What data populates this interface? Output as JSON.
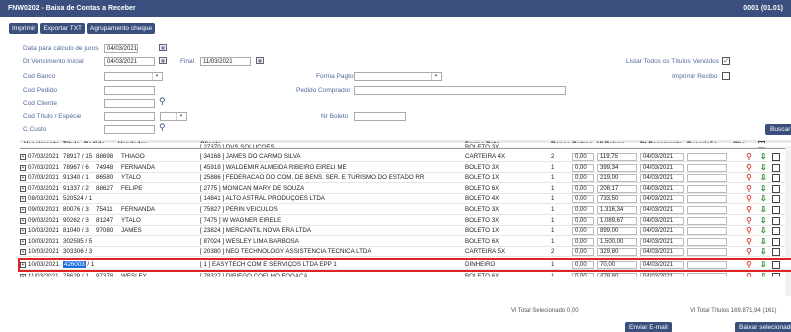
{
  "window": {
    "title": "FNW0202 - Baixa de Contas a Receber",
    "page_indicator": "0001 (01.01)"
  },
  "toolbar": {
    "imprimir": "Imprimir",
    "exportar": "Exportar TXT",
    "agrupamento": "Agrupamento cheque"
  },
  "filters": {
    "data_calc_label": "Data para cálculo de juros",
    "data_calc_value": "04/03/2021",
    "dt_venc_ini_label": "Dt Vencimento Inicial",
    "dt_venc_ini_value": "04/03/2021",
    "final_label": "Final",
    "final_value": "11/03/2021",
    "listar_label": "Listar Todos os Títulos Vencidos",
    "listar_checked": "✓",
    "cod_banco_label": "Cod Banco",
    "forma_pgto_label": "Forma Pagto",
    "imprimir_recibo_label": "Imprimir Recibo",
    "cod_pedido_label": "Cod Pedido",
    "pedido_comprador_label": "Pedido Comprador",
    "cod_cliente_label": "Cod Cliente",
    "cod_titulo_label": "Cod Título / Espécie",
    "nr_boleto_label": "Nr Boleto",
    "ccusto_label": "C.Custo",
    "buscar": "Buscar"
  },
  "grid": {
    "headers": {
      "vencimento": "Vencimento",
      "titulo": "Título",
      "pedido": "Pedido",
      "vendedor": "Vendedor",
      "cliente": "Cliente",
      "forma_pgto": "Forma Pgto",
      "banco": "Banco",
      "outros": "Outros",
      "vl_baixar": "Vl Baixar",
      "dt_pagamento": "Dt Pagamento",
      "descricao": "Descrição",
      "obs": "Obs."
    },
    "partial_top": {
      "venc": "",
      "titulo": "",
      "pedido": "",
      "vend": "",
      "cliente": "[ 27370 ] DVS SOLUCOES ...",
      "forma": "BOLETO 3X"
    },
    "rows": [
      {
        "venc": "07/03/2021",
        "titulo": "78917 / 15",
        "pedido": "88698",
        "vend": "THIAGO",
        "cliente": "[ 34168 ]  JAMES DO CARMO SILVA",
        "forma": "CARTEIRA 4X",
        "banco": "2",
        "outros": "0,00",
        "vl": "119,75",
        "dt": "04/03/2021"
      },
      {
        "venc": "07/03/2021",
        "titulo": "78967 / 6",
        "pedido": "74948",
        "vend": "FERNANDA",
        "cliente": "[ 45918 ]  WALDEMIR ALMEIDA RIBEIRO EIRELI ME",
        "forma": "BOLETO 3X",
        "banco": "1",
        "outros": "0,00",
        "vl": "399,34",
        "dt": "04/03/2021"
      },
      {
        "venc": "07/03/2021",
        "titulo": "91340 / 1",
        "pedido": "86580",
        "vend": "YTALO",
        "cliente": "[ 25886 ]  FEDERACAO DO COM. DE BENS. SER. E TURISMO DO ESTADO RR",
        "forma": "BOLETO 1X",
        "banco": "1",
        "outros": "0,00",
        "vl": "219,00",
        "dt": "04/03/2021"
      },
      {
        "venc": "07/03/2021",
        "titulo": "91337 / 2",
        "pedido": "88627",
        "vend": "FELIPE",
        "cliente": "[ 2775 ]  MONICAN MARY DE SOUZA",
        "forma": "BOLETO 6X",
        "banco": "1",
        "outros": "0,00",
        "vl": "208,17",
        "dt": "04/03/2021"
      },
      {
        "venc": "08/03/2021",
        "titulo": "520524 / 1",
        "pedido": "",
        "vend": "",
        "cliente": "[ 14841 ]  ALTO ASTRAL PRODUÇÕES LTDA",
        "forma": "BOLETO 4X",
        "banco": "1",
        "outros": "0,00",
        "vl": "733,50",
        "dt": "04/03/2021"
      },
      {
        "venc": "09/03/2021",
        "titulo": "80076 / 3",
        "pedido": "75411",
        "vend": "FERNANDA",
        "cliente": "[ 75827 ]  PERIN VEICULOS",
        "forma": "BOLETO 3X",
        "banco": "1",
        "outros": "0,00",
        "vl": "1.316,34",
        "dt": "04/03/2021"
      },
      {
        "venc": "09/03/2021",
        "titulo": "90262 / 3",
        "pedido": "81247",
        "vend": "YTALO",
        "cliente": "[ 7475 ]  W WAGNER EIRELE",
        "forma": "BOLETO 3X",
        "banco": "1",
        "outros": "0,00",
        "vl": "1.089,67",
        "dt": "04/03/2021"
      },
      {
        "venc": "10/03/2021",
        "titulo": "81040 / 3",
        "pedido": "97080",
        "vend": "JAMES",
        "cliente": "[ 23824 ]  MERCANTIL NOVA ERA LTDA",
        "forma": "BOLETO 1X",
        "banco": "1",
        "outros": "0,00",
        "vl": "899,00",
        "dt": "04/03/2021"
      },
      {
        "venc": "10/03/2021",
        "titulo": "302595 / 5",
        "pedido": "",
        "vend": "",
        "cliente": "[ 87024 ]  WESLEY LIMA BARBOSA",
        "forma": "BOLETO 6X",
        "banco": "1",
        "outros": "0,00",
        "vl": "1.500,00",
        "dt": "04/03/2021"
      },
      {
        "venc": "10/03/2021",
        "titulo": "303306 / 3",
        "pedido": "",
        "vend": "",
        "cliente": "[ 20380 ]  NEO TECHNOLOGY ASSISTENCIA TECNICA LTDA",
        "forma": "CARTEIRA 5X",
        "banco": "2",
        "outros": "0,00",
        "vl": "329,80",
        "dt": "04/03/2021"
      }
    ],
    "selected": {
      "venc": "10/03/2021",
      "titulo": "426003",
      "titulo_suffix": " / 1",
      "cliente": "[ 1 ]  EASYTECH COM E SERVIÇOS LTDA EPP 1",
      "forma": "DINHEIRO",
      "banco": "1",
      "outros": "0,00",
      "vl": "70,00",
      "dt": "04/03/2021"
    },
    "partial_bottom": {
      "venc": "11/03/2021",
      "titulo": "78629 / 1",
      "pedido": "97378",
      "vend": "WESLEY",
      "cliente": "[ 78327 ]  DIRIEGO COELHO FOGAÇA",
      "forma": "BOLETO 6X",
      "banco": "1",
      "outros": "0,00",
      "vl": "479,80",
      "dt": "04/03/2021"
    }
  },
  "footer": {
    "vl_total_sel": "Vl Total Selecionado 0,00",
    "vl_total_titulos": "Vl Total Títulos 169.871,94  (161)",
    "enviar_email": "Enviar E-mail",
    "baixar": "Baixar selecionados"
  }
}
